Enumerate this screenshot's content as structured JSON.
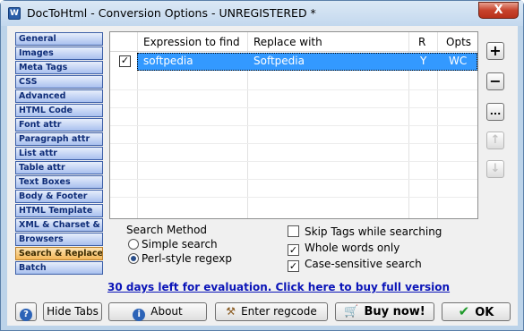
{
  "window": {
    "title": "DocToHtml - Conversion Options - UNREGISTERED *",
    "close_label": "X"
  },
  "sidebar": {
    "items": [
      {
        "label": "General"
      },
      {
        "label": "Images"
      },
      {
        "label": "Meta Tags"
      },
      {
        "label": "CSS"
      },
      {
        "label": "Advanced"
      },
      {
        "label": "HTML Code"
      },
      {
        "label": "Font attr"
      },
      {
        "label": "Paragraph attr"
      },
      {
        "label": "List attr"
      },
      {
        "label": "Table attr"
      },
      {
        "label": "Text Boxes"
      },
      {
        "label": "Body & Footer"
      },
      {
        "label": "HTML Template"
      },
      {
        "label": "XML & Charset & PG"
      },
      {
        "label": "Browsers"
      },
      {
        "label": "Search & Replace"
      },
      {
        "label": "Batch"
      }
    ],
    "active_index": 15
  },
  "grid": {
    "columns": [
      "Expression to find",
      "Replace with",
      "R",
      "Opts"
    ],
    "rows": [
      {
        "checked": true,
        "expression": "softpedia",
        "replace": "Softpedia",
        "r": "Y",
        "opts": "WC"
      }
    ]
  },
  "side_buttons": {
    "add": "+",
    "remove": "−",
    "edit": "...",
    "up": "↑",
    "down": "↓"
  },
  "search_method": {
    "title": "Search Method",
    "options": [
      {
        "label": "Simple search",
        "selected": false
      },
      {
        "label": "Perl-style regexp",
        "selected": true
      }
    ]
  },
  "checks": [
    {
      "label": "Skip Tags while searching",
      "checked": false
    },
    {
      "label": "Whole words only",
      "checked": true
    },
    {
      "label": "Case-sensitive search",
      "checked": true
    }
  ],
  "eval_link": "30 days left for evaluation. Click here to buy full version",
  "buttons": {
    "help": "?",
    "hide_tabs": "Hide Tabs",
    "about": "About",
    "enter_regcode": "Enter regcode",
    "buy_now": "Buy now!",
    "ok": "OK"
  },
  "colors": {
    "selection": "#3399ff",
    "link": "#0a14b8",
    "active_tab": "#f3b656"
  }
}
